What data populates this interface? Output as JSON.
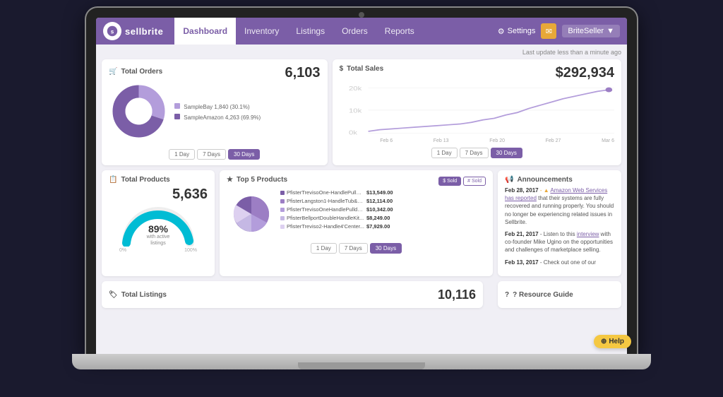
{
  "app": {
    "logo_text": "sellbrite",
    "last_update": "Last update less than a minute ago"
  },
  "nav": {
    "items": [
      {
        "label": "Dashboard",
        "active": true
      },
      {
        "label": "Inventory",
        "active": false
      },
      {
        "label": "Listings",
        "active": false
      },
      {
        "label": "Orders",
        "active": false
      },
      {
        "label": "Reports",
        "active": false
      }
    ],
    "settings_label": "Settings",
    "user_label": "BriteSeller"
  },
  "widgets": {
    "total_orders": {
      "title": "Total Orders",
      "value": "6,103",
      "legend": [
        {
          "label": "SampleBay 1,840 (30.1%)",
          "color": "#b39ddb"
        },
        {
          "label": "SampleAmazon 4,263 (69.9%)",
          "color": "#7b5ea7"
        }
      ],
      "time_buttons": [
        "1 Day",
        "7 Days",
        "30 Days"
      ],
      "active_time": "30 Days"
    },
    "total_sales": {
      "title": "Total Sales",
      "value": "$292,934",
      "y_labels": [
        "20k",
        "10k",
        "0k"
      ],
      "x_labels": [
        "Feb 6",
        "Feb 13",
        "Feb 20",
        "Feb 27",
        "Mar 6"
      ],
      "time_buttons": [
        "1 Day",
        "7 Days",
        "30 Days"
      ],
      "active_time": "30 Days"
    },
    "total_products": {
      "title": "Total Products",
      "value": "5,636",
      "gauge_pct": "89%",
      "gauge_sub": "with active listings",
      "gauge_labels": [
        "0%",
        "100%"
      ]
    },
    "top5_products": {
      "title": "Top 5 Products",
      "buttons": [
        "$ Sold",
        "# Sold"
      ],
      "active_btn": "$ Sold",
      "items": [
        {
          "name": "PfisterTrevisoOne-HandlePullD...",
          "value": "$13,549.00",
          "color": "#7b5ea7"
        },
        {
          "name": "PfisterLangston1-HandleTub&Sho...",
          "value": "$12,114.00",
          "color": "#9c7ec4"
        },
        {
          "name": "PfisterTrevisoOneHandlePulldow...",
          "value": "$10,342.00",
          "color": "#b39ddb"
        },
        {
          "name": "PfisterBellportDoubleHandleKit...",
          "value": "$8,249.00",
          "color": "#c5b8e4"
        },
        {
          "name": "PfisterTreviso2-Handle4'Center...",
          "value": "$7,929.00",
          "color": "#ddd0f0"
        }
      ],
      "time_buttons": [
        "1 Day",
        "7 Days",
        "30 Days"
      ],
      "active_time": "30 Days"
    },
    "announcements": {
      "title": "Announcements",
      "items": [
        {
          "date": "Feb 28, 2017",
          "warning": "▲",
          "link_text": "Amazon Web Services has reported",
          "body": " that their systems are fully recovered and running properly. You should no longer be experiencing related issues in Sellbrite."
        },
        {
          "date": "Feb 21, 2017",
          "body": " - Listen to this ",
          "link_text": "interview",
          "body2": " with co-founder Mike Ugino on the opportunities and challenges of marketplace selling."
        },
        {
          "date": "Feb 13, 2017",
          "body": " - Check out one of our"
        }
      ]
    },
    "total_listings": {
      "title": "Total Listings",
      "value": "10,116"
    },
    "resource_guide": {
      "title": "? Resource Guide"
    }
  },
  "help": {
    "label": "Help"
  }
}
